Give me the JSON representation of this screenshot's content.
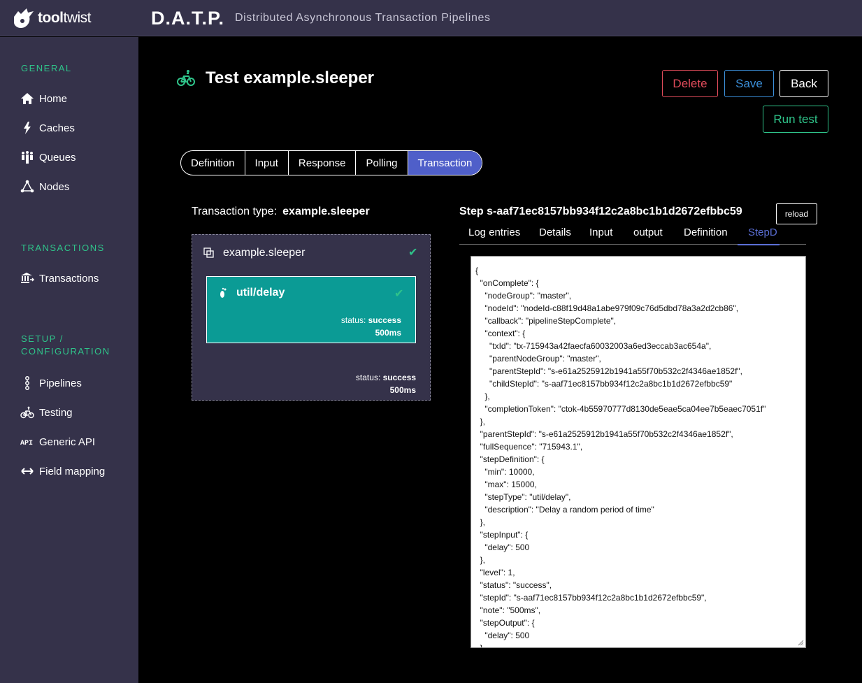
{
  "brand": {
    "logo_bold": "tool",
    "logo_light": "twist",
    "app_name": "D.A.T.P.",
    "app_subtitle": "Distributed Asynchronous Transaction Pipelines"
  },
  "sidebar": {
    "general_title": "GENERAL",
    "general_items": [
      {
        "label": "Home",
        "icon": "home-icon"
      },
      {
        "label": "Caches",
        "icon": "lightning-icon"
      },
      {
        "label": "Queues",
        "icon": "people-icon"
      },
      {
        "label": "Nodes",
        "icon": "nodes-icon"
      }
    ],
    "transactions_title": "TRANSACTIONS",
    "transactions_items": [
      {
        "label": "Transactions",
        "icon": "bank-icon"
      }
    ],
    "setup_title_1": "SETUP /",
    "setup_title_2": "CONFIGURATION",
    "setup_items": [
      {
        "label": "Pipelines",
        "icon": "pipeline-icon"
      },
      {
        "label": "Testing",
        "icon": "bicycle-icon"
      },
      {
        "label": "Generic API",
        "icon": "api-icon"
      },
      {
        "label": "Field mapping",
        "icon": "arrows-icon"
      }
    ]
  },
  "page": {
    "title": "Test example.sleeper"
  },
  "buttons": {
    "delete": "Delete",
    "save": "Save",
    "back": "Back",
    "run_test": "Run test",
    "reload": "reload"
  },
  "tabs": [
    "Definition",
    "Input",
    "Response",
    "Polling",
    "Transaction"
  ],
  "active_tab": "Transaction",
  "transaction": {
    "type_label": "Transaction type:",
    "type_value": "example.sleeper",
    "pipeline_name": "example.sleeper",
    "step_name": "util/delay",
    "step_status_label": "status:",
    "step_status": "success",
    "step_duration": "500ms",
    "pipeline_status_label": "status:",
    "pipeline_status": "success",
    "pipeline_duration": "500ms"
  },
  "step_panel": {
    "title": "Step s-aaf71ec8157bb934f12c2a8bc1b1d2672efbbc59",
    "subtabs": [
      "Log entries",
      "Details",
      "Input",
      "output",
      "Definition",
      "StepD"
    ],
    "active_subtab": "StepD",
    "json_text": "{\n  \"onComplete\": {\n    \"nodeGroup\": \"master\",\n    \"nodeId\": \"nodeId-c88f19d48a1abe979f09c76d5dbd78a3a2d2cb86\",\n    \"callback\": \"pipelineStepComplete\",\n    \"context\": {\n      \"txId\": \"tx-715943a42faecfa60032003a6ed3eccab3ac654a\",\n      \"parentNodeGroup\": \"master\",\n      \"parentStepId\": \"s-e61a2525912b1941a55f70b532c2f4346ae1852f\",\n      \"childStepId\": \"s-aaf71ec8157bb934f12c2a8bc1b1d2672efbbc59\"\n    },\n    \"completionToken\": \"ctok-4b55970777d8130de5eae5ca04ee7b5eaec7051f\"\n  },\n  \"parentStepId\": \"s-e61a2525912b1941a55f70b532c2f4346ae1852f\",\n  \"fullSequence\": \"715943.1\",\n  \"stepDefinition\": {\n    \"min\": 10000,\n    \"max\": 15000,\n    \"stepType\": \"util/delay\",\n    \"description\": \"Delay a random period of time\"\n  },\n  \"stepInput\": {\n    \"delay\": 500\n  },\n  \"level\": 1,\n  \"status\": \"success\",\n  \"stepId\": \"s-aaf71ec8157bb934f12c2a8bc1b1d2672efbbc59\",\n  \"note\": \"500ms\",\n  \"stepOutput\": {\n    \"delay\": 500\n  }"
  },
  "colors": {
    "sidebar_bg": "#35324a",
    "accent_green": "#2fc48a",
    "tab_active": "#4f5fc9",
    "step_teal": "#0b9b95",
    "delete_red": "#e24c5b",
    "save_blue": "#3b8fd9"
  }
}
